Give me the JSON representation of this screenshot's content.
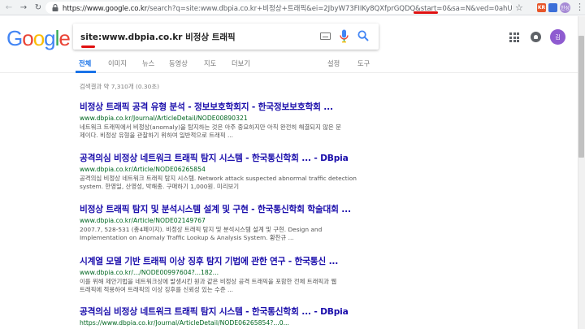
{
  "browser": {
    "url_host": "https://www.google.co.kr",
    "url_rest": "/search?q=site:www.dbpia.co.kr+비정상+트래픽&ei=2JbyW73FIIKy8QXfprGQDQ&start=0&sa=N&ved=0ahUKE",
    "ext1_label": "KR",
    "ext2_label": "",
    "profile_label": "한성"
  },
  "google": {
    "logo": [
      "G",
      "o",
      "o",
      "g",
      "l",
      "e"
    ],
    "logo_colors": [
      "#4285F4",
      "#EA4335",
      "#FBBC05",
      "#4285F4",
      "#34A853",
      "#EA4335"
    ],
    "search_value": "site:www.dbpia.co.kr 비정상 트래픽",
    "avatar_label": "김",
    "accent": "#1a73e8"
  },
  "tabs": {
    "all": "전체",
    "images": "이미지",
    "news": "뉴스",
    "videos": "동영상",
    "maps": "지도",
    "more": "더보기",
    "settings": "설정",
    "tools": "도구"
  },
  "stats": "검색결과 약 7,310개 (0.30초)",
  "results": [
    {
      "title": "비정상 트래픽 공격 유형 분석 - 정보보호학회지 - 한국정보보호학회 ...",
      "url": "www.dbpia.co.kr/Journal/ArticleDetail/NODE00890321",
      "snippet_1": "네트워크 트래픽에서 비정상(anomaly)을 탐지하는 것은 아주 중요하지만 아직 완전히 해결되지 않은 문",
      "snippet_2": "제이다. 비정상 유형을 관찰하기 위하여 일반적으로 트래픽 ..."
    },
    {
      "title": "공격의심 비정상 네트워크 트래픽 탐지 시스템 - 한국통신학회 ... - DBpia",
      "url": "www.dbpia.co.kr/Article/NODE06265854",
      "snippet_1": "공격의심 비정상 네트워크 트래픽 탐지 시스템. Network attack suspected abnormal traffic detection",
      "snippet_2": "system. 한영일, 산영성, 박해종. 구매하기 1,000원. 미리보기"
    },
    {
      "title": "비정상 트래픽 탐지 및 분석시스템 설계 및 구현 - 한국통신학회 학술대회 ...",
      "url": "www.dbpia.co.kr/Article/NODE02149767",
      "snippet_1": "2007.7, 528-531 (총4페이지). 비정상 트래픽 탐지 및 분석시스템 설계 및 구현. Design and",
      "snippet_2": "Implementation on Anomaly Traffic Lookup & Analysis System. 황찬규 ..."
    },
    {
      "title": "시계열 모델 기반 트래픽 이상 징후 탐지 기법에 관한 연구 - 한국통신 ...",
      "url": "www.dbpia.co.kr/.../NODE00997604?...182...",
      "snippet_1": "이를 위해 제안기법을 네트워크상에 발생시킨 원과 같은 비정상 공격 트래픽을 포함한 전체 트래픽과 웹",
      "snippet_2": "트래픽에 적용하여 트래픽의 이상 징후를 신뢰성 있는 수준 ..."
    },
    {
      "title": "공격의심 비정상 네트워크 트래픽 탐지 시스템 - 한국통신학회 ... - DBpia",
      "url": "https://www.dbpia.co.kr/Journal/ArticleDetail/NODE06265854?...0...",
      "snippet_1": "",
      "snippet_2": ""
    }
  ]
}
